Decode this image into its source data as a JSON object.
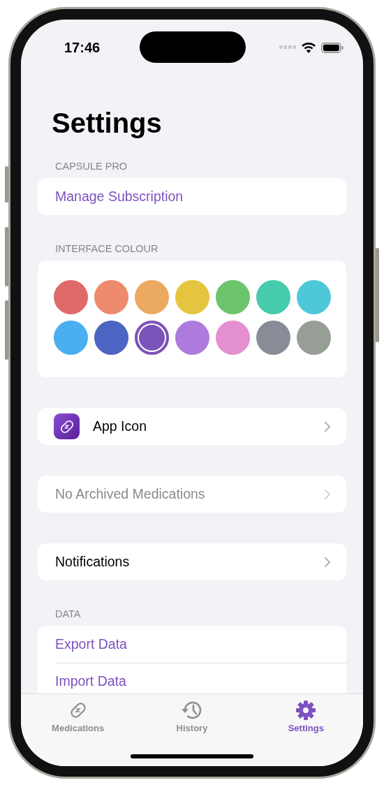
{
  "status_bar": {
    "time": "17:46"
  },
  "title": "Settings",
  "sections": [
    {
      "header": "CAPSULE PRO",
      "kind": "list",
      "rows": [
        {
          "kind": "link",
          "label": "Manage Subscription"
        }
      ]
    },
    {
      "header": "INTERFACE COLOUR",
      "kind": "colours",
      "colours": [
        {
          "color": "#e06a6a",
          "selected": false
        },
        {
          "color": "#ee8a6e",
          "selected": false
        },
        {
          "color": "#ecaa60",
          "selected": false
        },
        {
          "color": "#e5c53f",
          "selected": false
        },
        {
          "color": "#6cc56d",
          "selected": false
        },
        {
          "color": "#46cbad",
          "selected": false
        },
        {
          "color": "#4ec8d9",
          "selected": false
        },
        {
          "color": "#4aaff0",
          "selected": false
        },
        {
          "color": "#4d65c2",
          "selected": false
        },
        {
          "color": "#7c53b8",
          "selected": true
        },
        {
          "color": "#ad7bdd",
          "selected": false
        },
        {
          "color": "#e48fcf",
          "selected": false
        },
        {
          "color": "#878c96",
          "selected": false
        },
        {
          "color": "#969e96",
          "selected": false
        }
      ]
    },
    {
      "kind": "list",
      "rows": [
        {
          "kind": "app-icon",
          "label": "App Icon",
          "disabled": false
        }
      ]
    },
    {
      "kind": "list",
      "rows": [
        {
          "kind": "nav",
          "label": "No Archived Medications",
          "disabled": true
        }
      ]
    },
    {
      "kind": "list",
      "rows": [
        {
          "kind": "nav",
          "label": "Notifications",
          "disabled": false
        }
      ]
    },
    {
      "header": "DATA",
      "kind": "list",
      "rows": [
        {
          "kind": "link",
          "label": "Export Data"
        },
        {
          "kind": "link",
          "label": "Import Data"
        }
      ]
    }
  ],
  "tab_bar": {
    "tabs": [
      {
        "kind": "medications",
        "label": "Medications",
        "selected": false
      },
      {
        "kind": "history",
        "label": "History",
        "selected": false
      },
      {
        "kind": "settings",
        "label": "Settings",
        "selected": true
      }
    ]
  }
}
